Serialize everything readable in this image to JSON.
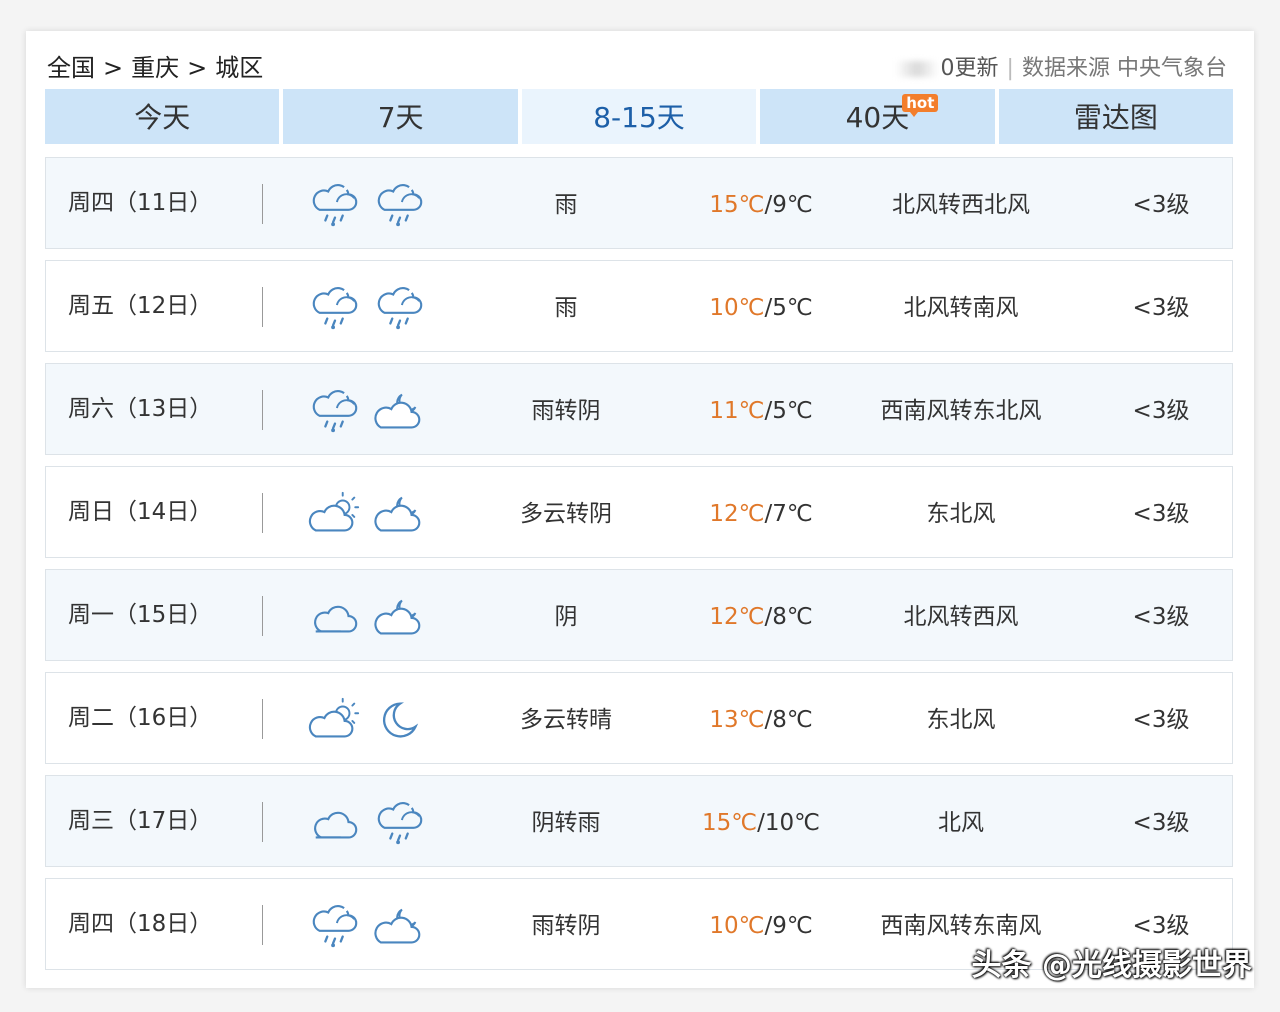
{
  "breadcrumb": {
    "country": "全国",
    "city": "重庆",
    "district": "城区",
    "separator": ">"
  },
  "meta": {
    "update_text": "0更新",
    "source_label": "数据来源",
    "source_name": "中央气象台"
  },
  "tabs": [
    {
      "label": "今天",
      "active": false
    },
    {
      "label": "7天",
      "active": false
    },
    {
      "label": "8-15天",
      "active": true
    },
    {
      "label": "40天",
      "active": false,
      "badge": "hot"
    },
    {
      "label": "雷达图",
      "active": false
    }
  ],
  "colors": {
    "tab_bg": "#cde4f8",
    "tab_active_text": "#1d5fa8",
    "high_temp": "#e0782a",
    "icon_stroke": "#4a86bf",
    "hot_badge": "#f37e2c"
  },
  "forecast": [
    {
      "date": "周四（11日）",
      "day_icon": "rain-cloud-icon",
      "night_icon": "rain-cloud-icon",
      "condition": "雨",
      "high": "15℃",
      "low": "9℃",
      "wind": "北风转西北风",
      "level": "<3级"
    },
    {
      "date": "周五（12日）",
      "day_icon": "rain-cloud-icon",
      "night_icon": "rain-cloud-icon",
      "condition": "雨",
      "high": "10℃",
      "low": "5℃",
      "wind": "北风转南风",
      "level": "<3级"
    },
    {
      "date": "周六（13日）",
      "day_icon": "rain-cloud-icon",
      "night_icon": "moon-cloud-icon",
      "condition": "雨转阴",
      "high": "11℃",
      "low": "5℃",
      "wind": "西南风转东北风",
      "level": "<3级"
    },
    {
      "date": "周日（14日）",
      "day_icon": "sun-cloud-icon",
      "night_icon": "moon-cloud-icon",
      "condition": "多云转阴",
      "high": "12℃",
      "low": "7℃",
      "wind": "东北风",
      "level": "<3级"
    },
    {
      "date": "周一（15日）",
      "day_icon": "cloud-icon",
      "night_icon": "moon-cloud-icon",
      "condition": "阴",
      "high": "12℃",
      "low": "8℃",
      "wind": "北风转西风",
      "level": "<3级"
    },
    {
      "date": "周二（16日）",
      "day_icon": "sun-cloud-icon",
      "night_icon": "moon-icon",
      "condition": "多云转晴",
      "high": "13℃",
      "low": "8℃",
      "wind": "东北风",
      "level": "<3级"
    },
    {
      "date": "周三（17日）",
      "day_icon": "cloud-icon",
      "night_icon": "rain-cloud-icon",
      "condition": "阴转雨",
      "high": "15℃",
      "low": "10℃",
      "wind": "北风",
      "level": "<3级"
    },
    {
      "date": "周四（18日）",
      "day_icon": "rain-cloud-icon",
      "night_icon": "moon-cloud-icon",
      "condition": "雨转阴",
      "high": "10℃",
      "low": "9℃",
      "wind": "西南风转东南风",
      "level": "<3级"
    }
  ],
  "watermark": "头条 @光线摄影世界"
}
